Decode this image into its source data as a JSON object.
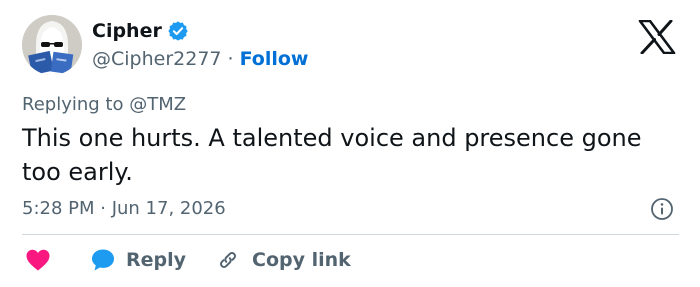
{
  "user": {
    "display_name": "Cipher",
    "handle": "@Cipher2277",
    "separator": "·",
    "follow_label": "Follow",
    "verified": true
  },
  "tweet": {
    "replying_prefix": "Replying to",
    "replying_to": "@TMZ",
    "text": "This one hurts. A talented voice and presence gone too early.",
    "timestamp": "5:28 PM · Jun 17, 2026"
  },
  "actions": {
    "like_icon": "heart-icon",
    "reply_label": "Reply",
    "copy_link_label": "Copy link"
  },
  "icons": {
    "brand": "x-logo-icon",
    "verified": "verified-badge-icon",
    "info": "info-icon",
    "reply": "reply-bubble-icon",
    "copy": "link-icon"
  },
  "colors": {
    "accent": "#1d9bf0",
    "follow": "#006fd6",
    "like": "#f91880",
    "muted": "#536471",
    "text": "#0f1419",
    "divider": "#cfd9de"
  }
}
